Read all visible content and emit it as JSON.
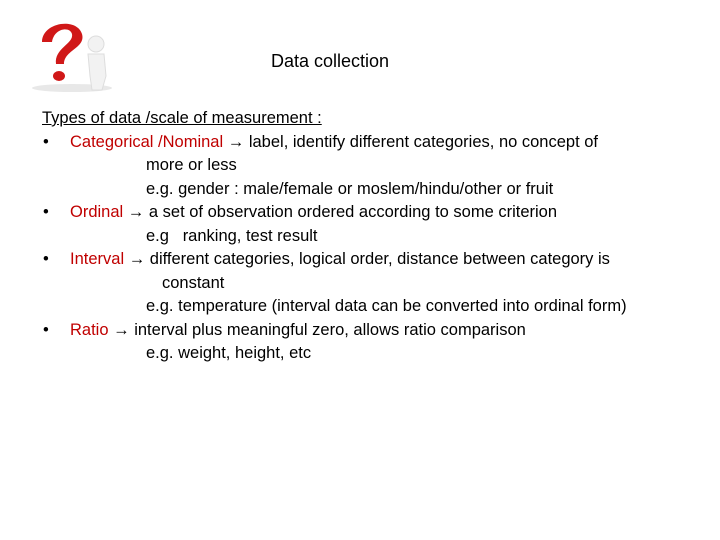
{
  "slide": {
    "title": "Data collection",
    "heading": "Types of data /scale of measurement :",
    "accent_color": "#c00000",
    "arrow": "→",
    "bullet": "•",
    "items": [
      {
        "term": "Categorical /Nominal",
        "desc": "label, identify different categories, no concept of",
        "desc_cont": "more or less",
        "example": "e.g. gender : male/female or moslem/hindu/other or fruit"
      },
      {
        "term": "Ordinal",
        "desc": "a set of observation ordered according to some criterion",
        "example": "e.g   ranking, test result"
      },
      {
        "term": "Interval",
        "desc": "different categories, logical order, distance between category is",
        "desc_cont": "constant",
        "example": "e.g. temperature (interval data can be converted into ordinal form)"
      },
      {
        "term": "Ratio",
        "desc": "interval plus meaningful zero, allows ratio comparison",
        "example": "e.g. weight, height, etc"
      }
    ]
  },
  "image": {
    "icon": "question-mark-figure-icon"
  }
}
